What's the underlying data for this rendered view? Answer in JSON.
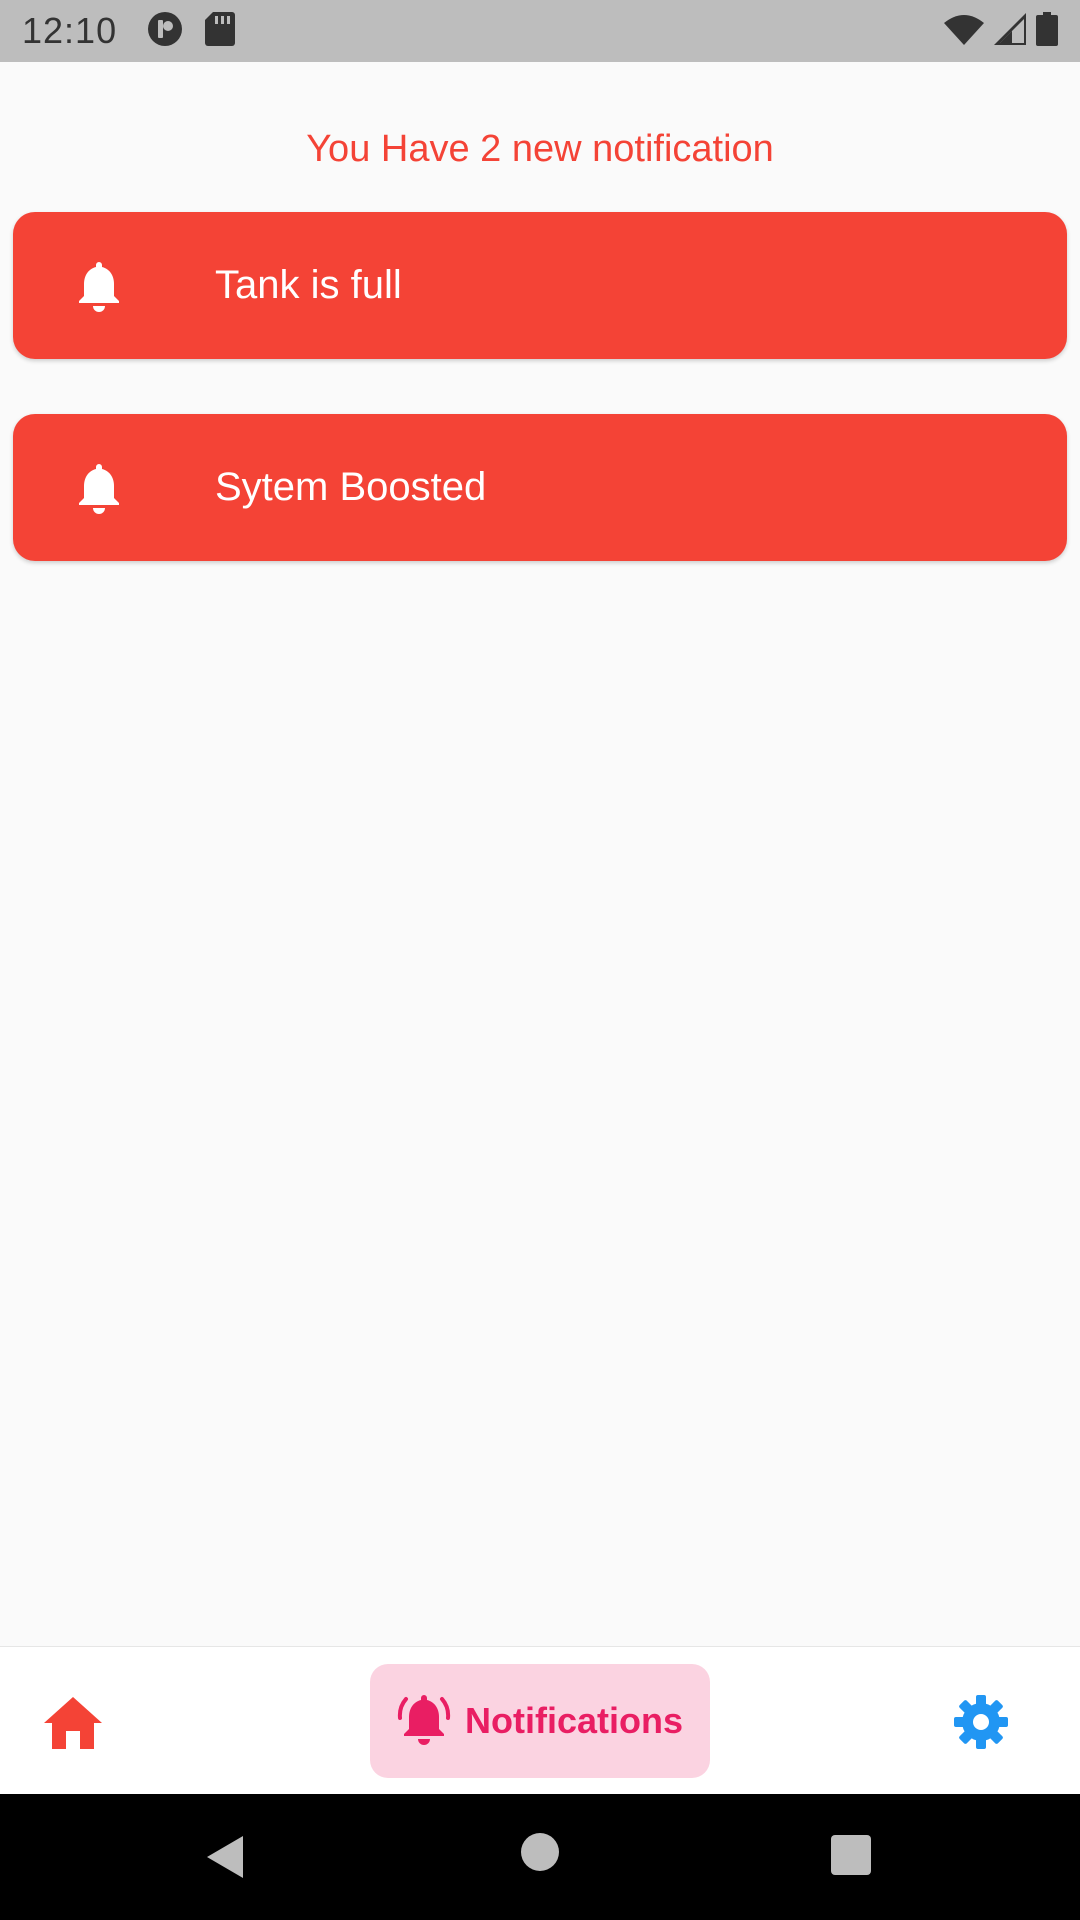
{
  "status_bar": {
    "time": "12:10",
    "left_icons": [
      "sync-icon",
      "sd-card-icon"
    ],
    "right_icons": [
      "wifi-icon",
      "cell-signal-icon",
      "battery-icon"
    ]
  },
  "main": {
    "header": "You Have 2 new notification",
    "notifications": [
      {
        "icon": "bell-icon",
        "label": "Tank is full"
      },
      {
        "icon": "bell-icon",
        "label": "Sytem Boosted"
      }
    ]
  },
  "bottom_nav": {
    "home_icon": "home-icon",
    "active_label": "Notifications",
    "active_icon": "bell-ringing-icon",
    "settings_icon": "gear-icon"
  },
  "system_nav": [
    "back-icon",
    "home-circle-icon",
    "recents-icon"
  ],
  "colors": {
    "accent_red": "#f44336",
    "pink": "#e91e63",
    "pink_pill": "#fbd3e1",
    "settings_blue": "#2196f3",
    "background": "#fafafa"
  }
}
